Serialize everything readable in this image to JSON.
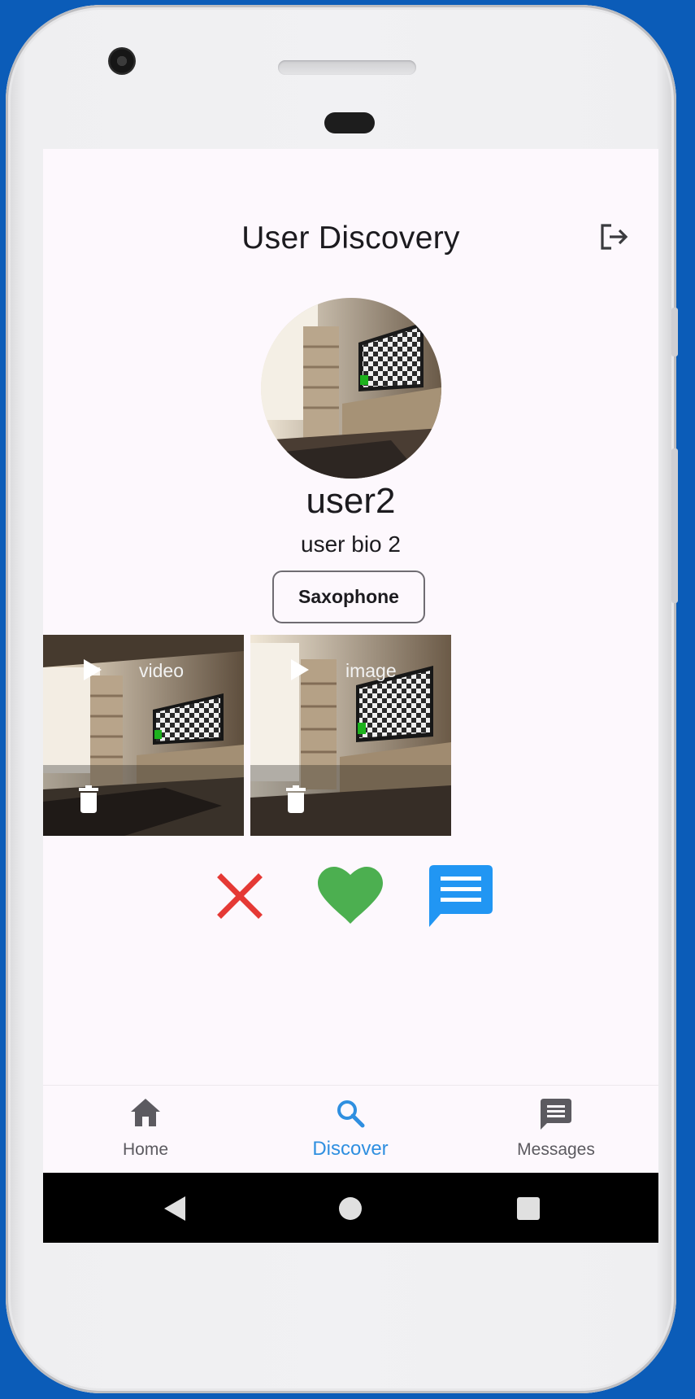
{
  "app_title": "User Discovery",
  "profile": {
    "username": "user2",
    "bio": "user bio 2",
    "tags": [
      "Saxophone"
    ]
  },
  "media": [
    {
      "label": "video",
      "icon": "play-icon",
      "delete_icon": "trash-icon"
    },
    {
      "label": "image",
      "icon": "play-icon",
      "delete_icon": "trash-icon"
    }
  ],
  "actions": {
    "dislike": {
      "icon": "close-icon",
      "color": "#e53935"
    },
    "like": {
      "icon": "heart-icon",
      "color": "#4caf50"
    },
    "message": {
      "icon": "chat-icon",
      "color": "#2196f3"
    }
  },
  "nav": {
    "items": [
      {
        "label": "Home",
        "icon": "home-icon",
        "active": false
      },
      {
        "label": "Discover",
        "icon": "search-icon",
        "active": true
      },
      {
        "label": "Messages",
        "icon": "message-icon",
        "active": false
      }
    ],
    "active_color": "#2f8fe0",
    "inactive_color": "#5c5a60"
  },
  "colors": {
    "background": "#0b5cb8",
    "screen": "#fdf8fd"
  }
}
